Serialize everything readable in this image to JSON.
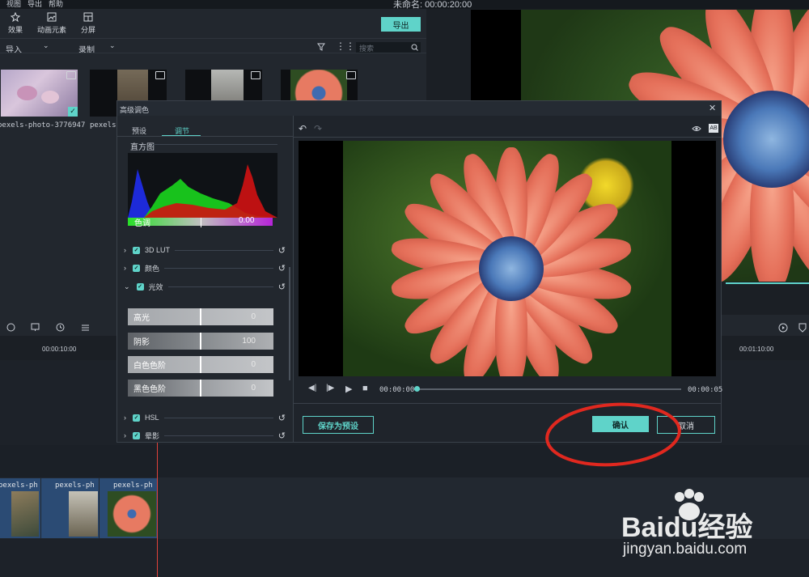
{
  "menu": {
    "items": [
      "视图",
      "导出",
      "帮助"
    ],
    "project_info": "未命名: 00:00:20:00"
  },
  "toolbar": {
    "tools": [
      {
        "label": "效果",
        "icon": "effects-icon"
      },
      {
        "label": "动画元素",
        "icon": "elements-icon"
      },
      {
        "label": "分屏",
        "icon": "split-screen-icon"
      }
    ],
    "export_label": "导出",
    "import_label": "导入",
    "record_label": "录制",
    "search_placeholder": "搜索"
  },
  "media": {
    "items": [
      {
        "name": "pexels-photo-3776947"
      },
      {
        "name": "pexels-p"
      },
      {
        "name": ""
      },
      {
        "name": ""
      }
    ]
  },
  "dialog": {
    "title": "高级调色",
    "tabs": [
      "预设",
      "调节"
    ],
    "active_tab": 1,
    "histogram_label": "直方图",
    "tone_label": "色调",
    "tone_value": "0.00",
    "sections": [
      {
        "label": "3D LUT",
        "checked": true,
        "expanded": false
      },
      {
        "label": "颜色",
        "checked": true,
        "expanded": false
      },
      {
        "label": "光效",
        "checked": true,
        "expanded": true
      }
    ],
    "sliders": [
      {
        "label": "高光",
        "value": "0"
      },
      {
        "label": "阴影",
        "value": "100"
      },
      {
        "label": "白色色阶",
        "value": "0"
      },
      {
        "label": "黑色色阶",
        "value": "0"
      }
    ],
    "sections_after": [
      {
        "label": "HSL",
        "checked": true
      },
      {
        "label": "晕影",
        "checked": true
      }
    ],
    "playback": {
      "current_time": "00:00:00",
      "total_time": "00:00:05",
      "progress": 0
    },
    "save_preset_label": "保存为预设",
    "confirm_label": "确认",
    "cancel_label": "取消"
  },
  "timeline": {
    "ticks": [
      "00:00:10:00",
      "00:01:10:00"
    ],
    "clips": [
      "pexels-ph",
      "pexels-ph",
      "pexels-ph"
    ]
  },
  "watermark": {
    "brand": "Baidu经验",
    "url": "jingyan.baidu.com"
  }
}
